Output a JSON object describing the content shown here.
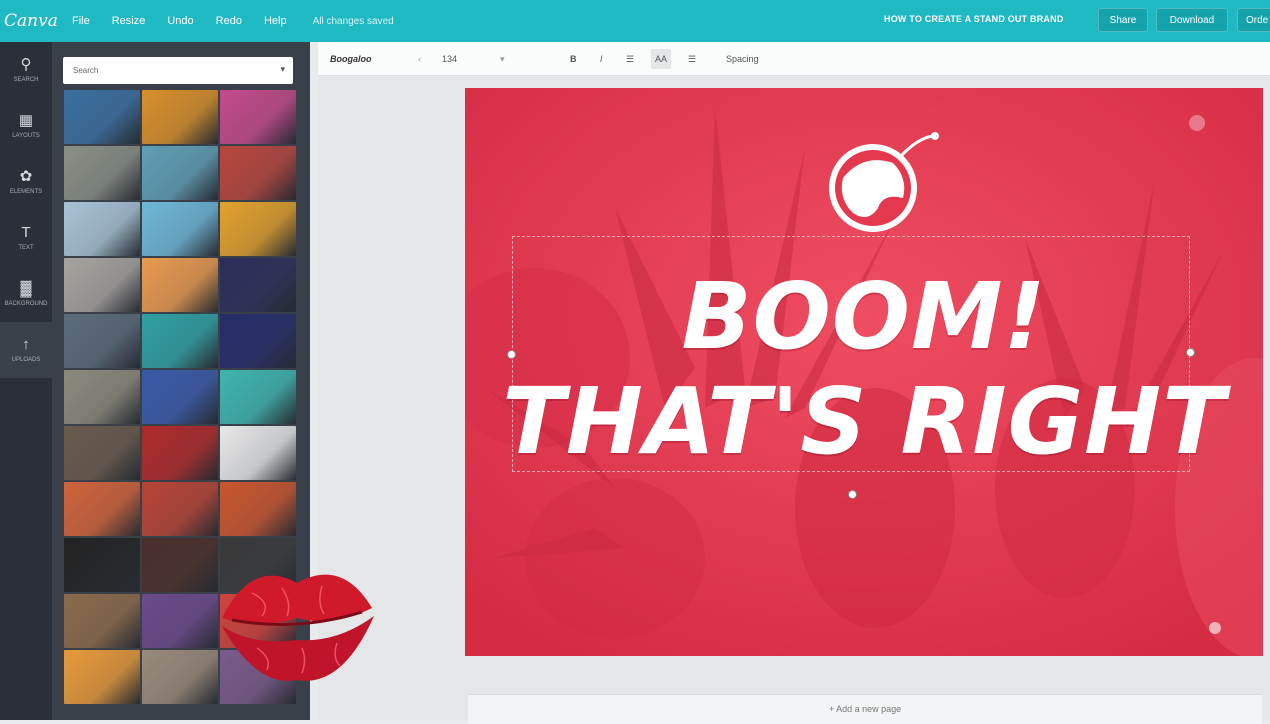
{
  "app": {
    "logo": "Canva",
    "menu": [
      "File",
      "Resize",
      "Undo",
      "Redo",
      "Help"
    ],
    "save_status": "All changes saved",
    "doc_title": "HOW TO CREATE A STAND OUT BRAND",
    "share_label": "Share",
    "download_label": "Download",
    "order_label": "Orde",
    "accent_color": "#1fb9c3"
  },
  "rail": [
    {
      "label": "Search",
      "icon": "search-icon"
    },
    {
      "label": "Layouts",
      "icon": "layouts-icon"
    },
    {
      "label": "Elements",
      "icon": "elements-icon"
    },
    {
      "label": "Text",
      "icon": "text-icon"
    },
    {
      "label": "Background",
      "icon": "background-icon"
    },
    {
      "label": "Uploads",
      "icon": "upload-icon"
    }
  ],
  "panel": {
    "search_value": "Search",
    "thumbnails": [
      "#3a6fa0",
      "#d9902a",
      "#c44a8c",
      "#8a8f86",
      "#5f9fb5",
      "#b8463d",
      "#a9c4d6",
      "#6fb8d8",
      "#e2a12d",
      "#a7a39f",
      "#e99a4e",
      "#2a2f5a",
      "#5b6b7a",
      "#2fa0a3",
      "#262c6a",
      "#8c8a7c",
      "#3a5aa8",
      "#3fb5b0",
      "#6a5a4c",
      "#b02a2a",
      "#e8e8e8",
      "#d0623a",
      "#b84436",
      "#c9562e",
      "#222222",
      "#4a2e2a",
      "#3a3a3a",
      "#8c6a4a",
      "#6b4a8a",
      "#d0433f",
      "#e89a3a",
      "#9a8a7a",
      "#7a5a8a"
    ]
  },
  "toolbar": {
    "font": "Boogaloo",
    "font_size": "134",
    "bold": "B",
    "italic": "I",
    "uppercase": "AA",
    "spacing": "Spacing"
  },
  "design": {
    "headline_line1": "BOOM!",
    "headline_line2": "THAT'S RIGHT",
    "background_color": "#e3384e"
  },
  "add_page_label": "+ Add a new page"
}
